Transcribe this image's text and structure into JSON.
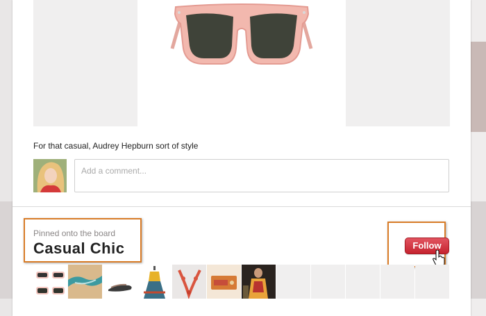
{
  "pin": {
    "description": "For that casual, Audrey Hepburn sort of style",
    "comment_placeholder": "Add a comment..."
  },
  "board": {
    "label": "Pinned onto the board",
    "title": "Casual Chic",
    "follow_label": "Follow",
    "thumbnails": [
      {
        "icon": "sunglasses-thumb"
      },
      {
        "icon": "scarf-thumb"
      },
      {
        "icon": "flats-shoes-thumb"
      },
      {
        "icon": "yellow-dress-thumb"
      },
      {
        "icon": "coral-necklace-thumb"
      },
      {
        "icon": "wallet-thumb"
      },
      {
        "icon": "outfit-photo-thumb"
      },
      {
        "icon": "empty-thumb"
      },
      {
        "icon": "empty-thumb"
      },
      {
        "icon": "empty-thumb"
      },
      {
        "icon": "empty-thumb"
      },
      {
        "icon": "empty-thumb"
      }
    ]
  },
  "colors": {
    "follow_button": "#cf2f3b",
    "highlight_border": "#d97c27"
  }
}
